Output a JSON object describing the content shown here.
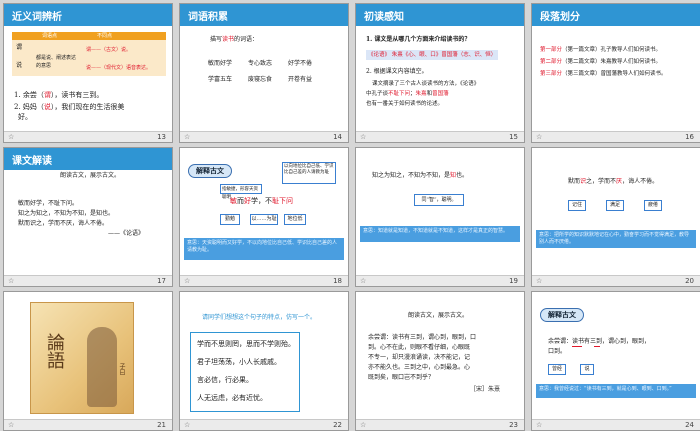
{
  "slides": [
    {
      "num": "13",
      "title": "近义词辨析",
      "table": {
        "h1": "词语点",
        "h2": "不同点",
        "w1": "谓",
        "w2": "说",
        "d1": "都是说、阐述表达的意思",
        "r1": "谓——（古文）说。",
        "r2": "说——（现代文）语音表达。"
      },
      "q1a": "1. 余尝",
      "q1red": "谓",
      "q1b": "），读书有三到。",
      "q2a": "2. 妈妈",
      "q2red": "说",
      "q2b": "），我们现在的生活很美",
      "q2c": "好。"
    },
    {
      "num": "14",
      "title": "词语积累",
      "intro_a": "描写",
      "intro_red": "读书",
      "intro_b": "的词语：",
      "row1": [
        "敏而好学",
        "专心致志",
        "好学不倦"
      ],
      "row2": [
        "学富五车",
        "废寝忘食",
        "开卷有益"
      ]
    },
    {
      "num": "15",
      "title": "初读感知",
      "q1": "1. 课文是从哪几个方面来介绍读书的？",
      "ans1": "《论语》 朱熹《心、眼、口》曾国藩（志、识、恒）",
      "q2": "2. 根据课文内容填空。",
      "t1": "课文摘录了三个古人谈读书的方法，《论语》",
      "t2": "中孔子谈",
      "t2r": "不耻下问",
      "t2b": "；",
      "t2c": "朱熹",
      "t2d": "和",
      "t2e": "曾国藩",
      "t3": "也有一番关于如何读书的论述。"
    },
    {
      "num": "16",
      "title": "段落划分",
      "p1a": "第一部分",
      "p1b": "（第一篇文章）孔子教导人们如何读书。",
      "p2a": "第二部分",
      "p2b": "（第二篇文章）朱熹教导人们如何读书。",
      "p3a": "第三部分",
      "p3b": "（第三篇文章）曾国藩教导人们如何读书。"
    },
    {
      "num": "17",
      "title": "课文解读",
      "head": "朗读古文，展示古文。",
      "l1": "敏而好学，不耻下问。",
      "l2": "知之为知之，不知为不知，是知也。",
      "l3": "默而识之，学而不厌，诲人不倦。",
      "src": "——《论语》"
    },
    {
      "num": "18",
      "badge": "解释古文",
      "bub1": "指敏捷，形容天资聪明",
      "bub2": "以向地位比自己低、学识比自己差的人请教为耻",
      "main_a": "敏",
      "main_b": "而",
      "main_c": "好",
      "main_d": "学，不",
      "main_e": "耻下问",
      "b1": "勤勉",
      "b2": "以……为耻",
      "b3": "地位低",
      "note": "意思：天资聪明而又好学，不以向地位比自己低、学识比自己差的人请教为耻。"
    },
    {
      "num": "19",
      "main_a": "知之为知之，不知为不知，是",
      "main_red": "知",
      "main_b": "也。",
      "bub": "同“智”，聪明。",
      "note": "意思：知道就是知道，不知道就是不知道，这样才是真正的智慧。"
    },
    {
      "num": "20",
      "main_a": "默而",
      "main_red1": "识",
      "main_b": "之，学而不",
      "main_red2": "厌",
      "main_c": "，诲人不倦。",
      "b1": "记住",
      "b2": "满足",
      "b3": "疲倦",
      "note": "意思：把所学的知识默默地记在心中，勤奋学习而不觉得满足，教导别人而不厌倦。"
    },
    {
      "num": "21",
      "calli": "論語",
      "sub": "子曰"
    },
    {
      "num": "22",
      "head": "请同学们想想这个句子的特点，仿写一个。",
      "l1": "学而不思则罔，思而不学则殆。",
      "l2": "君子坦荡荡，小人长戚戚。",
      "l3": "言必信，行必果。",
      "l4": "人无远虑，必有近忧。"
    },
    {
      "num": "23",
      "head": "朗读古文，展示古文。",
      "t1": "余尝谓：读书有三到，谓心到，眼到，口",
      "t2": "到。心不在此，则眼不看仔细，心眼既",
      "t3": "不专一，却只漫浪诵读，决不能记，记",
      "t4": "亦不能久也。三到之中，心到最急。心",
      "t5": "既到矣，眼口岂不到乎？",
      "src": "［宋］朱熹"
    },
    {
      "num": "24",
      "badge": "解释古文",
      "main": "余尝谓：读书有三到，谓心到，眼到，",
      "main2": "口到。",
      "b1": "曾经",
      "b2": "说",
      "note": "意思：我曾经说过：“读书有三到，就是心到、眼到、口到。”"
    }
  ],
  "colors": {
    "accent": "#2f95d3",
    "red": "#e0182c",
    "note": "#4a9ee0"
  },
  "icons": {
    "footer": "star-icon"
  }
}
